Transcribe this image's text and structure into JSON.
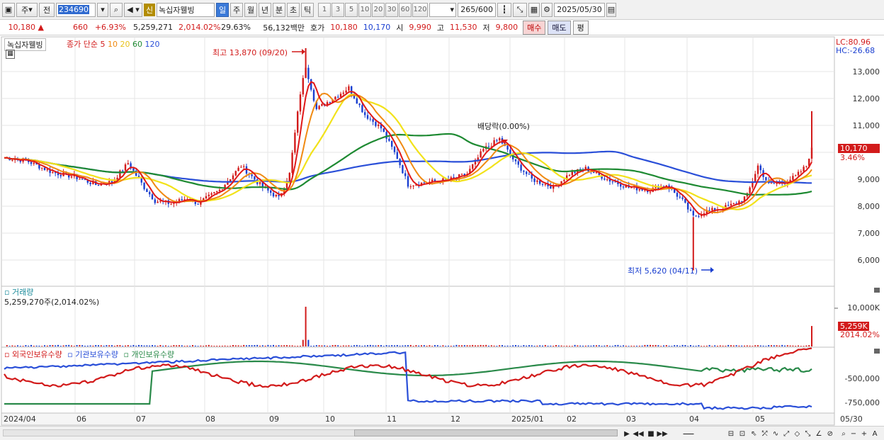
{
  "toolbar": {
    "market": "주",
    "mode": "전",
    "code": "234690",
    "sin": "신",
    "name": "녹십자웰빙",
    "periods": [
      "일",
      "주",
      "월",
      "년",
      "분",
      "초",
      "틱"
    ],
    "nums": [
      "1",
      "3",
      "5",
      "10",
      "20",
      "30",
      "60",
      "120"
    ],
    "count": "265",
    "count_max": "/600",
    "date": "2025/05/30"
  },
  "quote": {
    "price": "10,180",
    "change": "660",
    "change_pct": "+6.93%",
    "volume": "5,259,271",
    "vol_pct": "2,014.02%",
    "turnover_pct": "29.63%",
    "value": "56,132백만",
    "hoga_label": "호가",
    "hoga_ask": "10,180",
    "hoga_bid": "10,170",
    "open_label": "시",
    "open": "9,990",
    "high_label": "고",
    "high": "11,530",
    "low_label": "저",
    "low": "9,800",
    "buy": "매수",
    "sell": "매도",
    "eval": "평"
  },
  "legend": {
    "stock": "녹십자웰빙",
    "ma_label": "종가 단순",
    "ma": [
      "5",
      "10",
      "20",
      "60",
      "120"
    ]
  },
  "annotations": {
    "high": "최고 13,870 (09/20)",
    "low": "최저 5,620 (04/11)",
    "dividend": "배당락(0.00%)",
    "lc": "LC:80.96",
    "hc": "HC:-26.68",
    "price_box": "10,170",
    "price_pct": "3.46%",
    "vol_box": "5,259K",
    "vol_pct": "2014.02%"
  },
  "volume_panel": {
    "title": "거래량",
    "value": "5,259,270주(2,014.02%)",
    "ytick": "10,000K"
  },
  "holding_panel": {
    "series": [
      "외국인보유수량",
      "기관보유수량",
      "개인보유수량"
    ],
    "yticks": [
      "-500,000",
      "-750,000"
    ]
  },
  "colors": {
    "up": "#d21b1b",
    "down": "#1a3fd0",
    "ma5": "#e01818",
    "ma10": "#f08a12",
    "ma20": "#f2e21a",
    "ma60": "#1e8a32",
    "ma120": "#2a4fd8",
    "foreign": "#d21b1b",
    "inst": "#2a4fd8",
    "indiv": "#2a8a4a"
  },
  "chart_data": {
    "type": "candlestick",
    "price_axis": [
      13000,
      12000,
      11000,
      10000,
      9000,
      8000,
      7000,
      6000
    ],
    "price_labels": [
      "13,000",
      "12,000",
      "11,000",
      "10,000",
      "9,000",
      "8,000",
      "7,000",
      "6,000"
    ],
    "x_labels": [
      "2024/04",
      "06",
      "07",
      "08",
      "09",
      "10",
      "11",
      "12",
      "2025/01",
      "02",
      "03",
      "04",
      "05",
      "05/30"
    ],
    "price_path": [
      [
        0,
        9800
      ],
      [
        8,
        9700
      ],
      [
        18,
        9250
      ],
      [
        26,
        9100
      ],
      [
        34,
        8800
      ],
      [
        40,
        8900
      ],
      [
        46,
        9600
      ],
      [
        52,
        8700
      ],
      [
        56,
        8200
      ],
      [
        62,
        8100
      ],
      [
        68,
        8300
      ],
      [
        72,
        8100
      ],
      [
        80,
        8600
      ],
      [
        88,
        9500
      ],
      [
        96,
        8700
      ],
      [
        102,
        8300
      ],
      [
        106,
        9200
      ],
      [
        110,
        12200
      ],
      [
        112,
        13200
      ],
      [
        116,
        11600
      ],
      [
        122,
        12000
      ],
      [
        128,
        12400
      ],
      [
        134,
        11400
      ],
      [
        140,
        10900
      ],
      [
        146,
        9800
      ],
      [
        150,
        8800
      ],
      [
        158,
        8900
      ],
      [
        166,
        9000
      ],
      [
        172,
        9200
      ],
      [
        178,
        10100
      ],
      [
        184,
        10500
      ],
      [
        190,
        9600
      ],
      [
        196,
        9000
      ],
      [
        204,
        8700
      ],
      [
        210,
        9200
      ],
      [
        216,
        9400
      ],
      [
        224,
        9000
      ],
      [
        232,
        8700
      ],
      [
        240,
        8600
      ],
      [
        246,
        8800
      ],
      [
        252,
        8200
      ],
      [
        256,
        7600
      ],
      [
        260,
        7800
      ],
      [
        266,
        7900
      ],
      [
        272,
        8100
      ],
      [
        276,
        8400
      ],
      [
        280,
        9500
      ],
      [
        284,
        8800
      ],
      [
        290,
        8900
      ],
      [
        294,
        9100
      ],
      [
        298,
        9500
      ],
      [
        300,
        10180
      ]
    ],
    "ma5_end": 9600,
    "ma20_end": 9300,
    "ma60_end": 8500,
    "ma120_end": 8900,
    "volume_spikes": [
      [
        112,
        10200
      ],
      [
        300,
        5259
      ]
    ]
  }
}
